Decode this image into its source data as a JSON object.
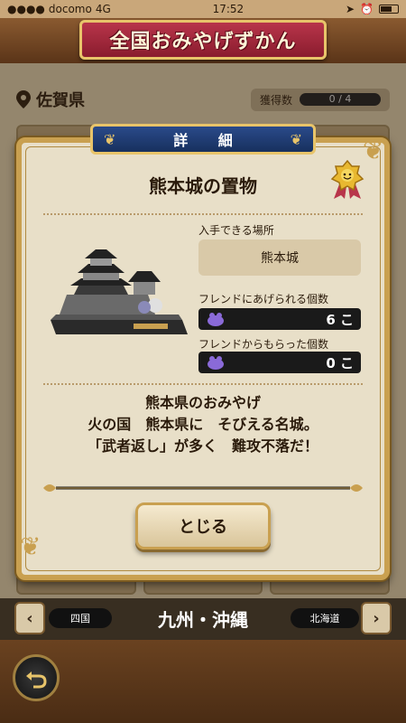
{
  "status_bar": {
    "carrier": "docomo",
    "network": "4G",
    "time": "17:52"
  },
  "header": {
    "title": "全国おみやげずかん"
  },
  "region": {
    "name": "佐賀県",
    "progress_label": "獲得数",
    "progress_value": "0 / 4",
    "progress_fraction": 0
  },
  "modal": {
    "tab_title": "詳 細",
    "item_name": "熊本城の置物",
    "place_label": "入手できる場所",
    "place_value": "熊本城",
    "give_label": "フレンドにあげられる個数",
    "give_count": "6 こ",
    "received_label": "フレンドからもらった個数",
    "received_count": "0 こ",
    "description_lines": [
      "熊本県のおみやげ",
      "火の国　熊本県に　そびえる名城。",
      "「武者返し」が多く　難攻不落だ！"
    ],
    "close_label": "とじる"
  },
  "nav": {
    "prev_label": "四国",
    "current_label": "九州・沖縄",
    "next_label": "北海道"
  },
  "colors": {
    "banner": "#b8354a",
    "tab": "#2a4a8a",
    "gold": "#c9a050",
    "panel": "#e8dfc8"
  },
  "icons": [
    "location-pin-icon",
    "medal-icon",
    "bag-icon",
    "arrow-left-icon",
    "arrow-right-icon",
    "back-icon"
  ]
}
